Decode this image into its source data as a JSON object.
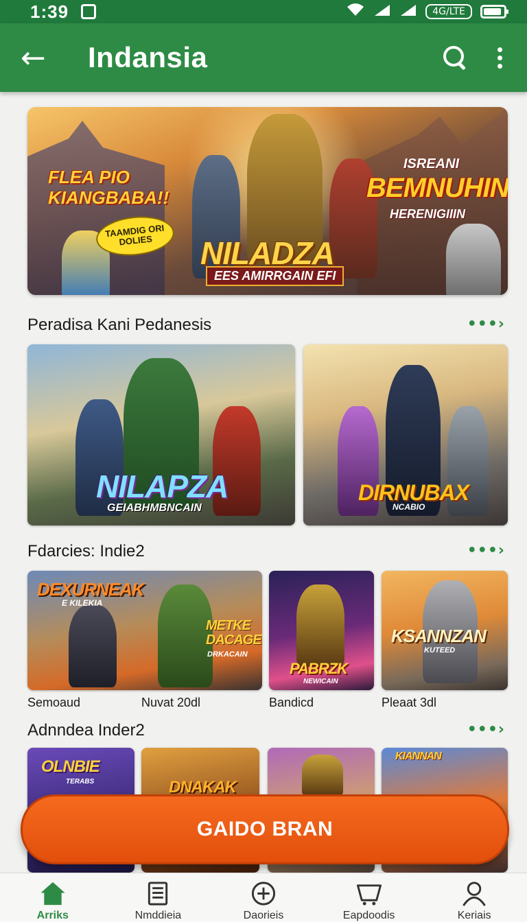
{
  "status_bar": {
    "time": "1:39",
    "network_badge": "4G/LTE",
    "battery_level": 0.9,
    "icons": [
      "note-icon",
      "wifi-icon",
      "signal-icon",
      "signal-icon",
      "battery-icon"
    ]
  },
  "app_bar": {
    "title": "Indansia",
    "back_icon": "arrow-left-icon",
    "search_icon": "search-icon",
    "menu_icon": "more-vert-icon"
  },
  "hero": {
    "left_text_line1": "FLEA PIO",
    "left_text_line2": "KIANGBABA!!",
    "pill_text": "TAAMDIG ORI DOLIES",
    "right_small": "ISREANI",
    "right_big": "BEMNUHIN",
    "right_sub": "HERENIGIIIN",
    "logo_main": "NILADZA",
    "logo_sub": "EES AMIRRGAIN EFI"
  },
  "sections": [
    {
      "title": "Peradisa Kani  Pedanesis",
      "more_label": "•••›",
      "cards": [
        {
          "title": "NILAPZA",
          "subtitle": "GEIABHMBNCAIN"
        },
        {
          "title": "DIRNUBAX",
          "subtitle": "NCABIO"
        }
      ]
    },
    {
      "title": "Fdarcies: Indie2",
      "more_label": "•••›",
      "cards": [
        {
          "title": "DEXURNEAK",
          "subtitle": "E KILEKIA",
          "extra_title": "METKE DACAGE",
          "extra_sub": "DRKACAIN",
          "caption_a": "Semoaud",
          "caption_b": "Nuvat 20dl"
        },
        {
          "title": "PABRZK",
          "subtitle": "NEWICAIN",
          "caption": "Bandicd"
        },
        {
          "title": "KSANNZAN",
          "subtitle": "KUTEED",
          "caption": "Pleaat 3dl"
        }
      ]
    },
    {
      "title": "Adnndea Inder2",
      "more_label": "•••›",
      "cards": [
        {
          "title": "OLNBIE",
          "subtitle": "TERABS"
        },
        {
          "title": "DNAKAK",
          "subtitle": ""
        },
        {
          "title": "",
          "subtitle": ""
        },
        {
          "title": "KIANNAN",
          "subtitle": ""
        }
      ]
    }
  ],
  "cta": {
    "label": "GAIDO BRAN"
  },
  "bottom_nav": [
    {
      "label": "Arriks",
      "icon": "home-icon",
      "active": true
    },
    {
      "label": "Nmddieia",
      "icon": "news-icon",
      "active": false
    },
    {
      "label": "Daorieis",
      "icon": "add-circle-icon",
      "active": false
    },
    {
      "label": "Eapdoodis",
      "icon": "cart-icon",
      "active": false
    },
    {
      "label": "Keriais",
      "icon": "profile-icon",
      "active": false
    }
  ],
  "colors": {
    "app_bar": "#2e8b45",
    "status_bar": "#1f7a3c",
    "accent_green": "#2e8b45",
    "cta_orange": "#f05f16",
    "background": "#f1f1ef"
  }
}
